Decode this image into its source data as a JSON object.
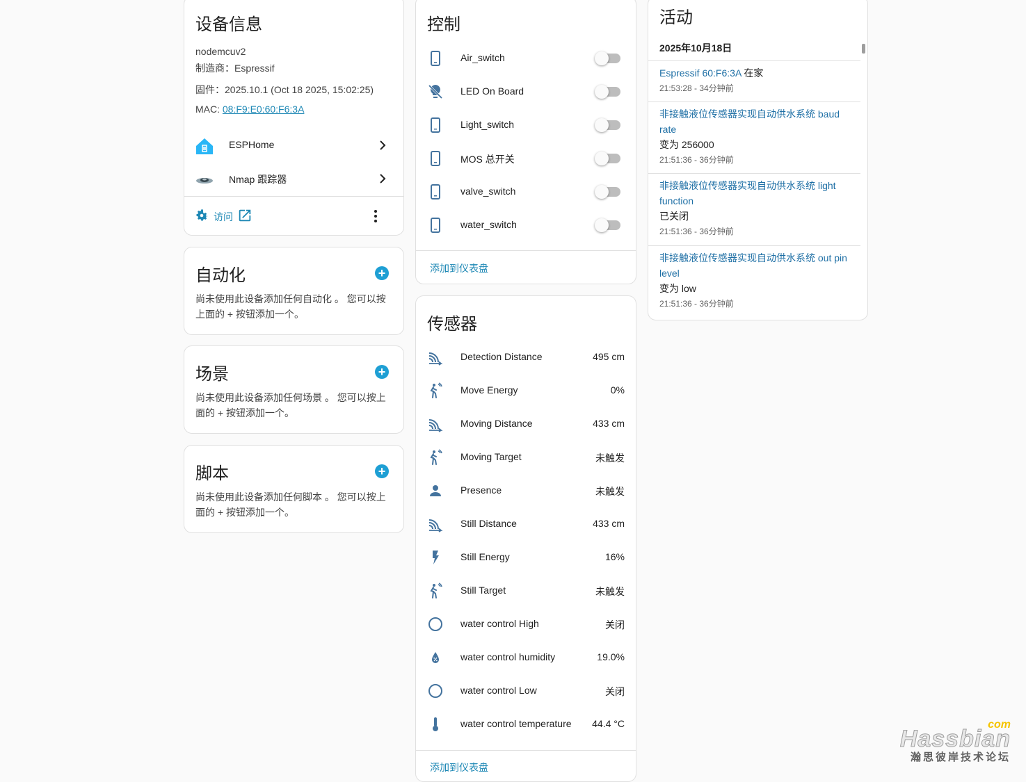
{
  "device_info": {
    "title": "设备信息",
    "model": "nodemcuv2",
    "manufacturer": "制造商：Espressif",
    "firmware": "固件：2025.10.1 (Oct 18 2025, 15:02:25)",
    "mac_label": "MAC: ",
    "mac_value": "08:F9:E0:60:F6:3A",
    "integrations": [
      {
        "label": "ESPHome",
        "icon": "esphome-icon"
      },
      {
        "label": "Nmap 跟踪器",
        "icon": "nmap-icon"
      }
    ],
    "visit_label": "访问"
  },
  "automation": {
    "title": "自动化",
    "desc": "尚未使用此设备添加任何自动化 。 您可以按上面的 + 按钮添加一个。"
  },
  "scenes": {
    "title": "场景",
    "desc": "尚未使用此设备添加任何场景 。 您可以按上面的 + 按钮添加一个。"
  },
  "scripts": {
    "title": "脚本",
    "desc": "尚未使用此设备添加任何脚本 。 您可以按上面的 + 按钮添加一个。"
  },
  "controls": {
    "title": "控制",
    "items": [
      {
        "label": "Air_switch",
        "icon": "phone-icon",
        "on": false
      },
      {
        "label": "LED On Board",
        "icon": "lightbulb-off-icon",
        "on": false
      },
      {
        "label": "Light_switch",
        "icon": "phone-icon",
        "on": false
      },
      {
        "label": "MOS 总开关",
        "icon": "phone-icon",
        "on": false
      },
      {
        "label": "valve_switch",
        "icon": "phone-icon",
        "on": false
      },
      {
        "label": "water_switch",
        "icon": "phone-icon",
        "on": false
      }
    ],
    "add_to_dashboard": "添加到仪表盘"
  },
  "sensors": {
    "title": "传感器",
    "items": [
      {
        "label": "Detection Distance",
        "value": "495 cm",
        "icon": "signal-distance-icon"
      },
      {
        "label": "Move Energy",
        "value": "0%",
        "icon": "motion-sensor-icon"
      },
      {
        "label": "Moving Distance",
        "value": "433 cm",
        "icon": "signal-distance-icon"
      },
      {
        "label": "Moving Target",
        "value": "未触发",
        "icon": "motion-sensor-icon"
      },
      {
        "label": "Presence",
        "value": "未触发",
        "icon": "account-icon"
      },
      {
        "label": "Still Distance",
        "value": "433 cm",
        "icon": "signal-distance-icon"
      },
      {
        "label": "Still Energy",
        "value": "16%",
        "icon": "flash-icon"
      },
      {
        "label": "Still Target",
        "value": "未触发",
        "icon": "motion-sensor-icon"
      },
      {
        "label": "water control High",
        "value": "关闭",
        "icon": "circle-outline-icon"
      },
      {
        "label": "water control humidity",
        "value": "19.0%",
        "icon": "water-percent-icon"
      },
      {
        "label": "water control Low",
        "value": "关闭",
        "icon": "circle-outline-icon"
      },
      {
        "label": "water control temperature",
        "value": "44.4 °C",
        "icon": "thermometer-icon"
      }
    ],
    "add_to_dashboard": "添加到仪表盘"
  },
  "activity": {
    "title": "活动",
    "date": "2025年10月18日",
    "entries": [
      {
        "title": "Espressif 60:F6:3A",
        "suffix": " 在家",
        "state": "",
        "time": "21:53:28 - 34分钟前"
      },
      {
        "title": "非接触液位传感器实现自动供水系统 baud rate",
        "suffix": "",
        "state": "变为 256000",
        "time": "21:51:36 - 36分钟前"
      },
      {
        "title": "非接触液位传感器实现自动供水系统 light function",
        "suffix": "",
        "state": "已关闭",
        "time": "21:51:36 - 36分钟前"
      },
      {
        "title": "非接触液位传感器实现自动供水系统 out pin level",
        "suffix": "",
        "state": "变为 low",
        "time": "21:51:36 - 36分钟前"
      }
    ]
  },
  "watermark": {
    "brand": "Hassbian",
    "tld": "com",
    "subtitle": "瀚思彼岸技术论坛"
  },
  "colors": {
    "accent": "#1e88b5",
    "icon": "#44739e",
    "toggle_off": "#bdbdbd"
  }
}
